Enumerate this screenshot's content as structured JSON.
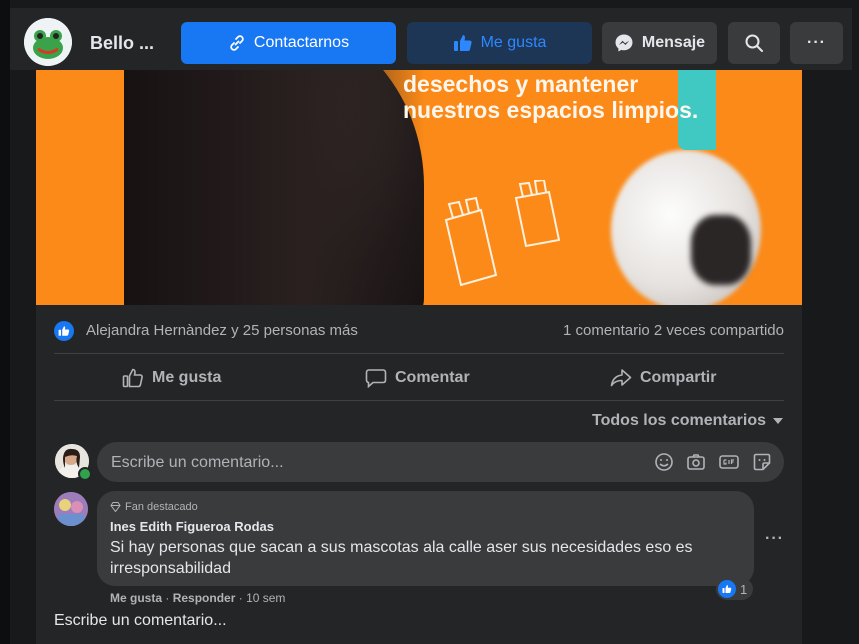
{
  "header": {
    "page_name": "Bello ...",
    "contact_label": "Contactarnos",
    "like_label": "Me gusta",
    "message_label": "Mensaje",
    "more_label": "···"
  },
  "post": {
    "image_text": "desechos y mantener nuestros espacios limpios.",
    "reactions_text": "Alejandra Hernàndez y 25 personas más",
    "comments_shares": "1 comentario  2 veces compartido",
    "actions": {
      "like": "Me gusta",
      "comment": "Comentar",
      "share": "Compartir"
    },
    "sort_label": "Todos los comentarios",
    "comment_placeholder": "Escribe un comentario..."
  },
  "comments": [
    {
      "badge": "Fan destacado",
      "author": "Ines Edith Figueroa Rodas",
      "text": "Si hay personas que sacan a sus mascotas ala calle aser sus necesidades eso es irresponsabilidad",
      "reaction_count": "1",
      "like_link": "Me gusta",
      "reply_link": "Responder",
      "time": "10 sem"
    }
  ],
  "bottom_prompt": "Escribe un comentario...",
  "colors": {
    "accent": "#1877f2",
    "photo_bg": "#fb8a18",
    "surface": "#242526"
  }
}
